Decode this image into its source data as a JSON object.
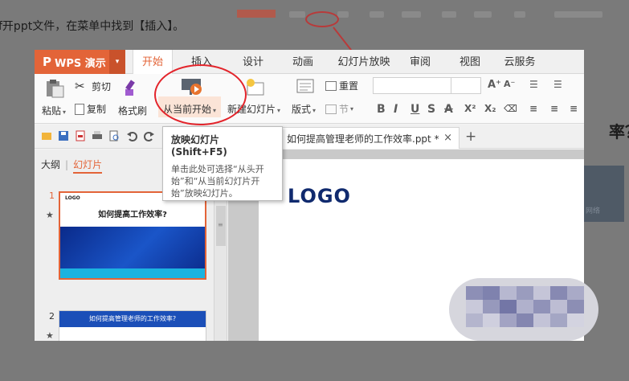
{
  "background": {
    "instruction_text": "f开ppt文件，在菜单中找到【插入】。",
    "right_text": "率？",
    "right_image_caption": "网络"
  },
  "app": {
    "name": "WPS 演示",
    "logo_letter": "P",
    "menu_caret": "▾"
  },
  "tabs": [
    "开始",
    "插入",
    "设计",
    "动画",
    "幻灯片放映",
    "审阅",
    "视图",
    "云服务"
  ],
  "active_tab": "开始",
  "ribbon": {
    "paste": "粘贴",
    "cut": "剪切",
    "copy": "复制",
    "format_painter": "格式刷",
    "play_from_current": "从当前开始",
    "new_slide": "新建幻灯片",
    "layout": "版式",
    "section": "节",
    "reset": "重置",
    "format_buttons": [
      "B",
      "I",
      "U",
      "S",
      "A",
      "X²",
      "X₂"
    ]
  },
  "doc_tab": {
    "title": "如何提高管理老师的工作效率.ppt *",
    "close": "×",
    "new_tab": "+"
  },
  "left_panel": {
    "tab_outline": "大纲",
    "tab_slides": "幻灯片",
    "slide1_number": "1",
    "slide2_number": "2",
    "slide1_logo": "LOGO",
    "slide1_title": "如何提高工作效率?",
    "slide2_title": "如何提高管理老师的工作效率?"
  },
  "slide": {
    "logo": "LOGO"
  },
  "tooltip": {
    "title": "放映幻灯片 (Shift+F5)",
    "body": "单击此处可选择“从头开始”和“从当前幻灯片开始”放映幻灯片。"
  },
  "colors": {
    "accent": "#e36438",
    "annotation": "#e3242b",
    "logo": "#102a6e"
  }
}
